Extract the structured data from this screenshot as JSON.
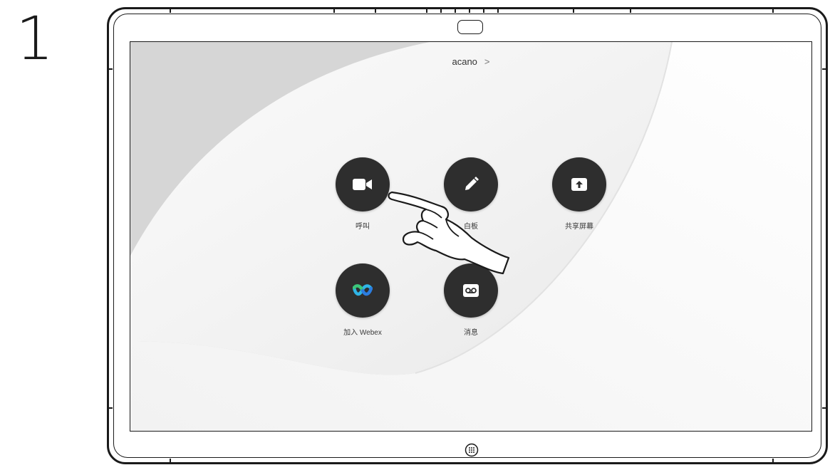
{
  "step_number": "1",
  "device_name": "acano",
  "device_name_chevron": ">",
  "actions": [
    {
      "id": "call",
      "label": "呼叫",
      "icon": "video-camera-icon"
    },
    {
      "id": "whiteboard",
      "label": "白板",
      "icon": "pencil-icon"
    },
    {
      "id": "share_screen",
      "label": "共享屏幕",
      "icon": "share-screen-icon"
    },
    {
      "id": "join_webex",
      "label": "加入 Webex",
      "icon": "webex-logo-icon"
    },
    {
      "id": "messages",
      "label": "消息",
      "icon": "voicemail-icon"
    }
  ],
  "colors": {
    "button_bg": "#2e2e2e",
    "wallpaper_light": "#f6f6f6",
    "wallpaper_dark": "#d3d3d3",
    "device_outline": "#1a1a1a"
  }
}
